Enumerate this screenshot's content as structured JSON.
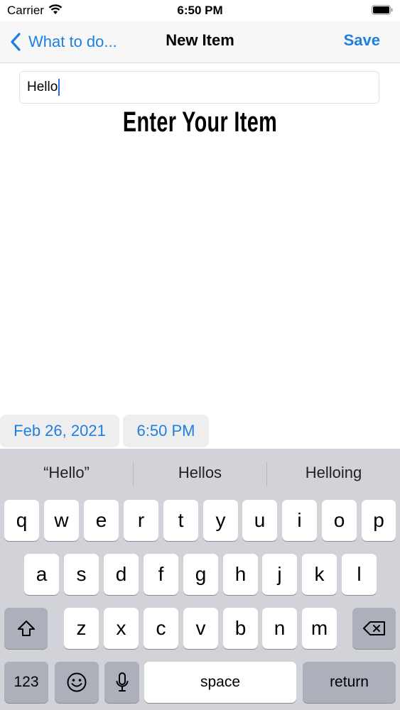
{
  "status": {
    "carrier": "Carrier",
    "time": "6:50 PM"
  },
  "nav": {
    "back_label": "What to do...",
    "title": "New Item",
    "save_label": "Save"
  },
  "item_field": {
    "value": "Hello"
  },
  "heading": "Enter Your Item",
  "date_picker": {
    "date": "Feb 26, 2021",
    "time": "6:50 PM"
  },
  "keyboard": {
    "suggestions": [
      "“Hello”",
      "Hellos",
      "Helloing"
    ],
    "row1": [
      "q",
      "w",
      "e",
      "r",
      "t",
      "y",
      "u",
      "i",
      "o",
      "p"
    ],
    "row2": [
      "a",
      "s",
      "d",
      "f",
      "g",
      "h",
      "j",
      "k",
      "l"
    ],
    "row3": [
      "z",
      "x",
      "c",
      "v",
      "b",
      "n",
      "m"
    ],
    "numbers_label": "123",
    "space_label": "space",
    "return_label": "return",
    "icons": {
      "shift": "shift-icon",
      "delete": "delete-icon",
      "emoji": "emoji-icon",
      "mic": "microphone-icon"
    }
  },
  "colors": {
    "accent": "#1f7fe0",
    "keyboard_bg": "#d1d3d9",
    "fn_key": "#acb0ba"
  }
}
